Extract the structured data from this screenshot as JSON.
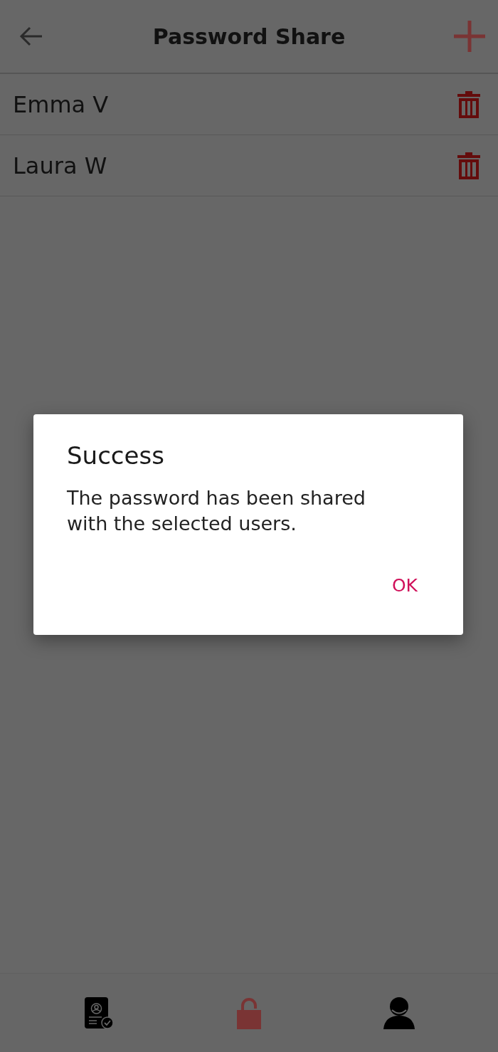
{
  "header": {
    "title": "Password Share"
  },
  "users": [
    {
      "name": "Emma V"
    },
    {
      "name": "Laura W"
    }
  ],
  "dialog": {
    "title": "Success",
    "message": "The password has been shared with the selected users.",
    "button": "OK"
  },
  "bottom_nav": [
    {
      "kind": "document",
      "selected": false
    },
    {
      "kind": "lock",
      "selected": true
    },
    {
      "kind": "profile",
      "selected": false
    }
  ]
}
